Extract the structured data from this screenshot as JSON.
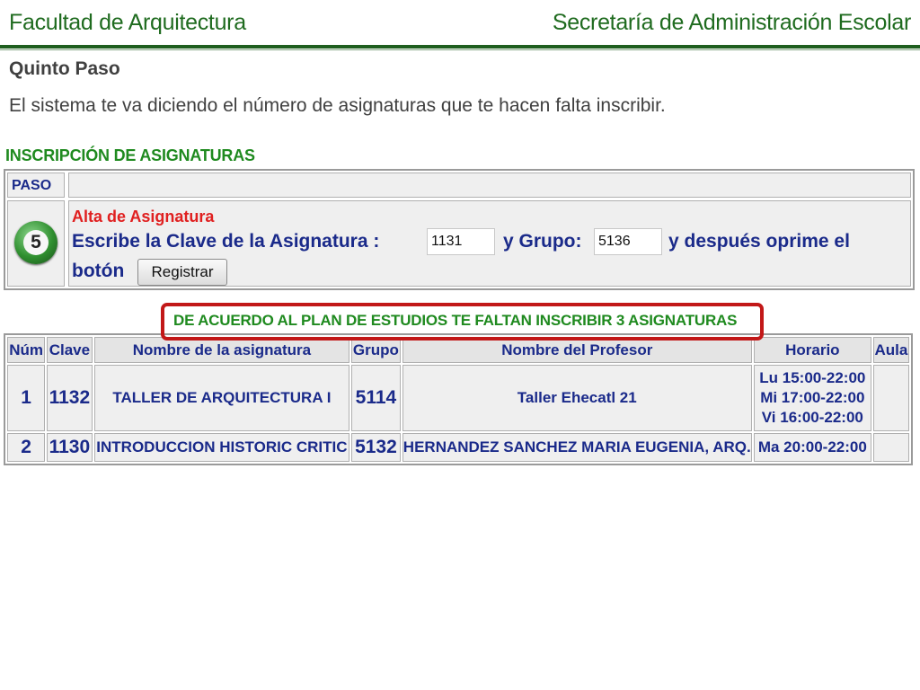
{
  "header": {
    "left_title": "Facultad de Arquitectura",
    "right_title": "Secretaría de Administración Escolar"
  },
  "step": {
    "title": "Quinto Paso",
    "description": "El sistema te va diciendo el número de asignaturas que te hacen falta inscribir."
  },
  "panel": {
    "title": "INSCRIPCIÓN DE ASIGNATURAS",
    "paso_label": "PASO",
    "step_number": "5",
    "alta_label": "Alta de Asignatura",
    "instruction_clave": "Escribe la Clave de la Asignatura :",
    "clave_value": "1131",
    "instruction_grupo": "y Grupo:",
    "grupo_value": "5136",
    "instruction_despues": "y después oprime el",
    "instruction_boton": "botón",
    "register_button": "Registrar"
  },
  "notice": "DE ACUERDO AL PLAN DE ESTUDIOS TE FALTAN INSCRIBIR 3 ASIGNATURAS",
  "schedule": {
    "headers": [
      "Núm",
      "Clave",
      "Nombre de la asignatura",
      "Grupo",
      "Nombre del Profesor",
      "Horario",
      "Aula"
    ],
    "rows": [
      {
        "num": "1",
        "clave": "1132",
        "nombre": "TALLER DE ARQUITECTURA I",
        "grupo": "5114",
        "profesor": "Taller Ehecatl  21",
        "horario": [
          "Lu 15:00-22:00",
          "Mi 17:00-22:00",
          "Vi 16:00-22:00"
        ],
        "aula": ""
      },
      {
        "num": "2",
        "clave": "1130",
        "nombre": "INTRODUCCION HISTORIC CRITIC",
        "grupo": "5132",
        "profesor": "HERNANDEZ SANCHEZ MARIA EUGENIA, ARQ.",
        "horario": [
          "Ma 20:00-22:00"
        ],
        "aula": ""
      }
    ]
  },
  "colors": {
    "header_green": "#1f6b1f",
    "title_green": "#1f8a1f",
    "label_blue": "#1a2a8a",
    "alert_red": "#e02020",
    "highlight_red": "#c21818"
  }
}
